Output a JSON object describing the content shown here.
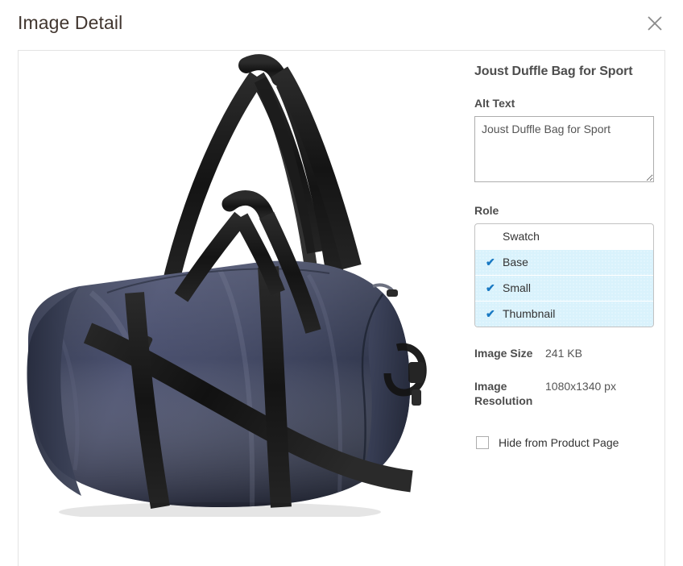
{
  "header": {
    "title": "Image Detail",
    "close_icon": "close-icon"
  },
  "detail": {
    "product_title": "Joust Duffle Bag for Sport",
    "alt_text": {
      "label": "Alt Text",
      "value": "Joust Duffle Bag for Sport",
      "placeholder": ""
    },
    "role": {
      "label": "Role",
      "options": [
        {
          "label": "Swatch",
          "selected": false
        },
        {
          "label": "Base",
          "selected": true
        },
        {
          "label": "Small",
          "selected": true
        },
        {
          "label": "Thumbnail",
          "selected": true
        }
      ],
      "check_glyph": "✔"
    },
    "image_size": {
      "label": "Image Size",
      "value": "241 KB"
    },
    "image_resolution": {
      "label": "Image Resolution",
      "value": "1080x1340 px"
    },
    "hide_from_product_page": {
      "label": "Hide from Product Page",
      "checked": false
    }
  },
  "preview": {
    "image_name": "joust-duffle-bag-product-photo",
    "alt": "Joust Duffle Bag for Sport"
  },
  "colors": {
    "accent_blue": "#1979c3",
    "selected_row_bg": "#d9f2fc",
    "title_text": "#41362f",
    "label_text": "#4d4d4d",
    "bag_navy": "#3b4159",
    "bag_navy_light": "#4e5470",
    "bag_strap_black": "#1b1b1b"
  }
}
